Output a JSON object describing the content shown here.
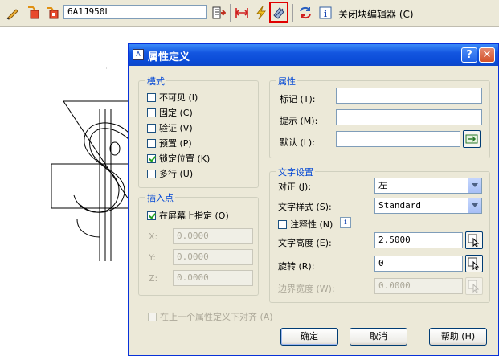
{
  "toolbar": {
    "block_name": "6A1J950L",
    "close_label": "关闭块编辑器 (C)",
    "icons": [
      "edit-block-icon",
      "save-block-icon",
      "save-block-as-icon",
      "authoring-palettes-icon",
      "parameter-icon",
      "action-icon",
      "define-attribute-icon",
      "update-icon",
      "info-icon"
    ]
  },
  "dialog": {
    "title": "属性定义",
    "help_glyph": "?",
    "close_glyph": "✕",
    "mode": {
      "title": "模式",
      "items": [
        {
          "label": "不可见 (I)",
          "checked": false
        },
        {
          "label": "固定 (C)",
          "checked": false
        },
        {
          "label": "验证 (V)",
          "checked": false
        },
        {
          "label": "预置 (P)",
          "checked": false
        },
        {
          "label": "锁定位置 (K)",
          "checked": true
        },
        {
          "label": "多行 (U)",
          "checked": false
        }
      ]
    },
    "attribute": {
      "title": "属性",
      "tag_label": "标记 (T):",
      "prompt_label": "提示 (M):",
      "default_label": "默认 (L):",
      "tag_value": "",
      "prompt_value": "",
      "default_value": ""
    },
    "insert": {
      "title": "插入点",
      "on_screen_label": "在屏幕上指定 (O)",
      "on_screen_checked": true,
      "x_label": "X:",
      "y_label": "Y:",
      "z_label": "Z:",
      "x_value": "0.0000",
      "y_value": "0.0000",
      "z_value": "0.0000"
    },
    "text": {
      "title": "文字设置",
      "justify_label": "对正 (J):",
      "justify_value": "左",
      "style_label": "文字样式 (S):",
      "style_value": "Standard",
      "annotative_label": "注释性 (N)",
      "annotative_checked": false,
      "info_glyph": "i",
      "height_label": "文字高度 (E):",
      "height_value": "2.5000",
      "rotation_label": "旋转 (R):",
      "rotation_value": "0",
      "boundary_label": "边界宽度 (W):",
      "boundary_value": "0.0000"
    },
    "align_below_label": "在上一个属性定义下对齐 (A)",
    "buttons": {
      "ok": "确定",
      "cancel": "取消",
      "help": "帮助 (H)"
    }
  },
  "colors": {
    "accent": "#0046d5",
    "highlight": "#e00000",
    "titlebar": "#0a4bd6"
  }
}
